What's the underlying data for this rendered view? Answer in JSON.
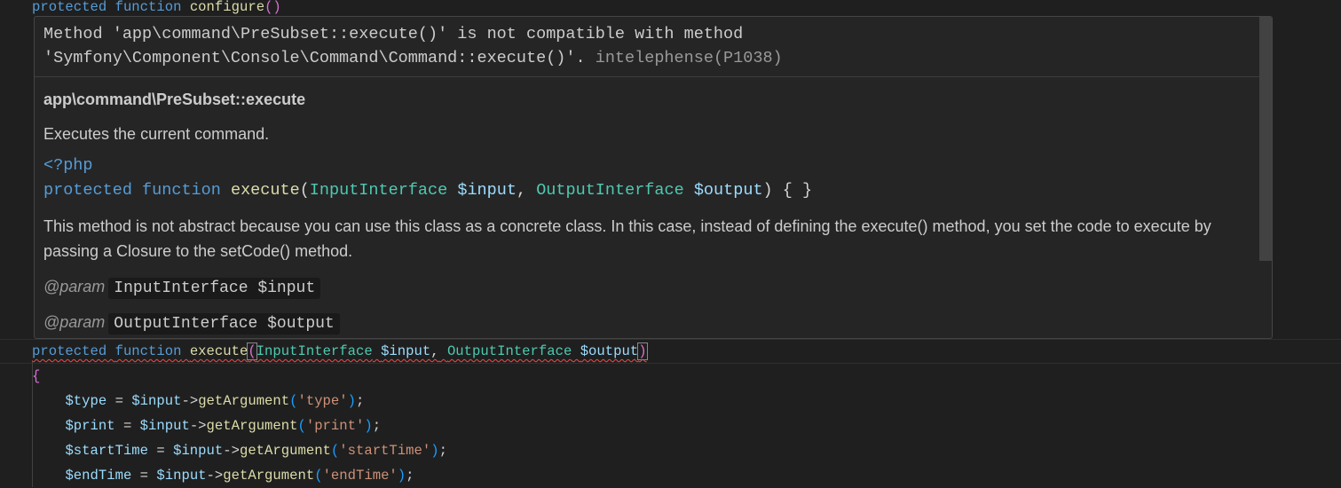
{
  "editor": {
    "line_configure": {
      "kw1": "protected",
      "kw2": "function",
      "name": "configure",
      "open": "(",
      "close": ")"
    },
    "line_execute": {
      "kw1": "protected",
      "kw2": "function",
      "name": "execute",
      "open": "(",
      "t1": "InputInterface",
      "v1": "$input",
      "comma": ",",
      "t2": "OutputInterface",
      "v2": "$output",
      "close": ")"
    },
    "brace": "{",
    "statements": [
      {
        "var": "$type",
        "eq": " = ",
        "obj": "$input",
        "arrow": "->",
        "fn": "getArgument",
        "open": "(",
        "arg": "'type'",
        "close": ")",
        "semi": ";"
      },
      {
        "var": "$print",
        "eq": " = ",
        "obj": "$input",
        "arrow": "->",
        "fn": "getArgument",
        "open": "(",
        "arg": "'print'",
        "close": ")",
        "semi": ";"
      },
      {
        "var": "$startTime",
        "eq": " = ",
        "obj": "$input",
        "arrow": "->",
        "fn": "getArgument",
        "open": "(",
        "arg": "'startTime'",
        "close": ")",
        "semi": ";"
      },
      {
        "var": "$endTime",
        "eq": " = ",
        "obj": "$input",
        "arrow": "->",
        "fn": "getArgument",
        "open": "(",
        "arg": "'endTime'",
        "close": ")",
        "semi": ";"
      }
    ]
  },
  "hover": {
    "diagnostic_line1": "Method 'app\\command\\PreSubset::execute()' is not compatible with method",
    "diagnostic_line2": "'Symfony\\Component\\Console\\Command\\Command::execute()'.",
    "diagnostic_source": "intelephense(P1038)",
    "signature": "app\\command\\PreSubset::execute",
    "summary": "Executes the current command.",
    "php_tag": "<?php",
    "code": {
      "kw1": "protected",
      "kw2": "function",
      "name": "execute",
      "open": "(",
      "t1": "InputInterface",
      "v1": "$input",
      "comma": ", ",
      "t2": "OutputInterface",
      "v2": "$output",
      "close": ")",
      "body": " { }"
    },
    "description": "This method is not abstract because you can use this class as a concrete class. In this case, instead of defining the execute() method, you set the code to execute by passing a Closure to the setCode() method.",
    "params": [
      {
        "tag": "@param",
        "value": "InputInterface $input"
      },
      {
        "tag": "@param",
        "value": "OutputInterface $output"
      }
    ]
  }
}
